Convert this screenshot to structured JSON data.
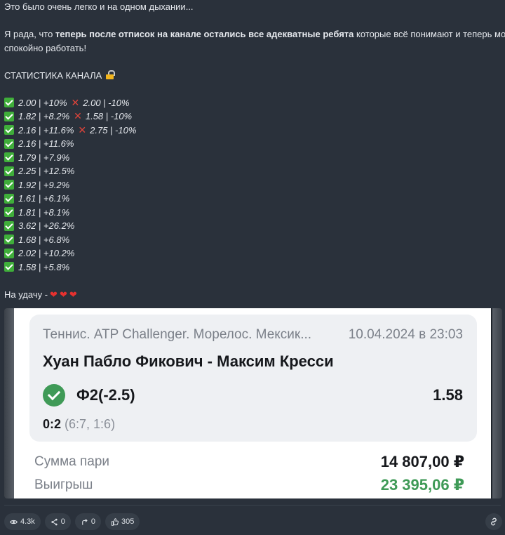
{
  "message": {
    "intro": "Это было очень легко и на одном дыхании...",
    "para_prefix": "Я рада, что ",
    "para_bold": "теперь после отписок на канале остались все адекватные ребята",
    "para_rest1": " которые всё понимают и теперь можно",
    "para_line2": "спокойно работать!",
    "stats_title": "СТАТИСТИКА КАНАЛА",
    "stats": [
      {
        "win": "2.00 | +10%",
        "loss": "2.00 | -10%"
      },
      {
        "win": "1.82 | +8.2%",
        "loss": "1.58 | -10%"
      },
      {
        "win": "2.16 | +11.6%",
        "loss": "2.75 | -10%"
      },
      {
        "win": "2.16 | +11.6%"
      },
      {
        "win": "1.79 | +7.9%"
      },
      {
        "win": "2.25 | +12.5%"
      },
      {
        "win": "1.92 | +9.2%"
      },
      {
        "win": "1.61 | +6.1%"
      },
      {
        "win": "1.81 | +8.1%"
      },
      {
        "win": "3.62 | +26.2%"
      },
      {
        "win": "1.68 | +6.8%"
      },
      {
        "win": "2.02 | +10.2%"
      },
      {
        "win": "1.58 | +5.8%"
      }
    ],
    "luck": "На удачу -"
  },
  "bet_card": {
    "league": "Теннис. ATP Challenger. Морелос. Мексик...",
    "datetime": "10.04.2024 в 23:03",
    "match": "Хуан Пабло Фикович - Максим Кресси",
    "bet": "Ф2(-2.5)",
    "coef": "1.58",
    "score": "0:2",
    "sets": "(6:7, 1:6)",
    "stake_label": "Сумма пари",
    "stake_value": "14 807,00 ₽",
    "win_label": "Выигрыш",
    "win_value": "23 395,06 ₽"
  },
  "footer": {
    "views": "4.3k",
    "shares": "0",
    "forwards": "0",
    "likes": "305"
  },
  "colors": {
    "background": "#2a313b",
    "win_green": "#3f9a57",
    "cross_red": "#e0443a"
  }
}
